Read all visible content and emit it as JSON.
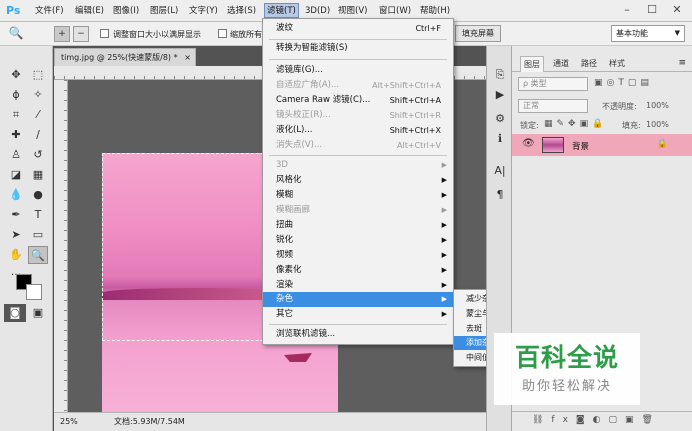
{
  "app": {
    "logo": "Ps"
  },
  "menubar": {
    "items": [
      "文件(F)",
      "编辑(E)",
      "图像(I)",
      "图层(L)",
      "文字(Y)",
      "选择(S)",
      "滤镜(T)",
      "3D(D)",
      "视图(V)",
      "窗口(W)",
      "帮助(H)"
    ],
    "active": "滤镜(T)"
  },
  "options": {
    "resize_windows_label": "调整窗口大小以满屏显示",
    "zoom_all_label": "缩放所有",
    "fill_screen_label": "填充屏幕",
    "workspace": "基本功能"
  },
  "document": {
    "tab": "timg.jpg @ 25%(快速蒙版/8) *",
    "zoom": "25%",
    "doc_info": "文档:5.93M/7.54M"
  },
  "filter_menu": {
    "items": [
      {
        "label": "波纹",
        "shortcut": "Ctrl+F"
      },
      {
        "label": "转换为智能滤镜(S)"
      },
      {
        "label": "滤镜库(G)..."
      },
      {
        "label": "自适应广角(A)...",
        "shortcut": "Alt+Shift+Ctrl+A",
        "disabled": true
      },
      {
        "label": "Camera Raw 滤镜(C)...",
        "shortcut": "Shift+Ctrl+A"
      },
      {
        "label": "镜头校正(R)...",
        "shortcut": "Shift+Ctrl+R",
        "disabled": true
      },
      {
        "label": "液化(L)...",
        "shortcut": "Shift+Ctrl+X"
      },
      {
        "label": "消失点(V)...",
        "shortcut": "Alt+Ctrl+V",
        "disabled": true
      },
      {
        "label": "3D",
        "disabled": true,
        "submenu": true
      },
      {
        "label": "风格化",
        "submenu": true
      },
      {
        "label": "模糊",
        "submenu": true
      },
      {
        "label": "模糊画廊",
        "disabled": true,
        "submenu": true
      },
      {
        "label": "扭曲",
        "submenu": true
      },
      {
        "label": "锐化",
        "submenu": true
      },
      {
        "label": "视频",
        "submenu": true
      },
      {
        "label": "像素化",
        "submenu": true
      },
      {
        "label": "渲染",
        "submenu": true
      },
      {
        "label": "杂色",
        "submenu": true,
        "highlighted": true
      },
      {
        "label": "其它",
        "submenu": true
      },
      {
        "label": "浏览联机滤镜..."
      }
    ]
  },
  "noise_submenu": {
    "items": [
      "减少杂色...",
      "蒙尘与划痕...",
      "去斑",
      "添加杂色...",
      "中间值..."
    ],
    "highlighted": "添加杂色..."
  },
  "layers_panel": {
    "tabs": [
      "图层",
      "通道",
      "路径",
      "样式"
    ],
    "kind_filter": "ρ 类型",
    "blend_mode": "正常",
    "opacity_label": "不透明度:",
    "opacity_value": "100%",
    "lock_label": "锁定:",
    "fill_label": "填充:",
    "fill_value": "100%",
    "layer_name": "背景"
  },
  "watermark": {
    "title": "百科全说",
    "subtitle": "助你轻松解决"
  },
  "colors": {
    "highlight": "#3b8ee2",
    "layer_selected": "#f0a7b9",
    "watermark_green": "#2e9c48"
  }
}
